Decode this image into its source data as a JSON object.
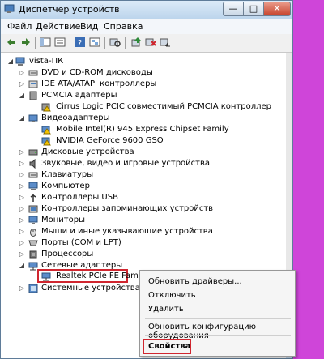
{
  "window": {
    "title": "Диспетчер устройств",
    "close_glyph": "✕",
    "min_glyph": "—",
    "max_glyph": "□"
  },
  "menu": [
    "Файл",
    "Действие",
    "Вид",
    "Справка"
  ],
  "toolbar_icons": [
    "back-arrow-icon",
    "forward-arrow-icon",
    "properties-panel-icon",
    "list-view-icon",
    "help-icon",
    "resources-view-icon",
    "scan-hardware-icon",
    "update-driver-icon",
    "uninstall-icon",
    "disable-device-icon"
  ],
  "tree": {
    "root": "vista-ПК",
    "items": [
      {
        "label": "DVD и CD-ROM дисководы",
        "expanded": false
      },
      {
        "label": "IDE ATA/ATAPI контроллеры",
        "expanded": false
      },
      {
        "label": "PCMCIA адаптеры",
        "expanded": true,
        "children": [
          "Cirrus Logic PCIC совместимый PCMCIA контроллер"
        ]
      },
      {
        "label": "Видеоадаптеры",
        "expanded": true,
        "children": [
          "Mobile Intel(R) 945 Express Chipset Family",
          "NVIDIA GeForce 9600 GSO"
        ]
      },
      {
        "label": "Дисковые устройства",
        "expanded": false
      },
      {
        "label": "Звуковые, видео и игровые устройства",
        "expanded": false
      },
      {
        "label": "Клавиатуры",
        "expanded": false
      },
      {
        "label": "Компьютер",
        "expanded": false
      },
      {
        "label": "Контроллеры USB",
        "expanded": false
      },
      {
        "label": "Контроллеры запоминающих устройств",
        "expanded": false
      },
      {
        "label": "Мониторы",
        "expanded": false
      },
      {
        "label": "Мыши и иные указывающие устройства",
        "expanded": false
      },
      {
        "label": "Порты (COM и LPT)",
        "expanded": false
      },
      {
        "label": "Процессоры",
        "expanded": false
      },
      {
        "label": "Сетевые адаптеры",
        "expanded": true,
        "children": [
          "Realtek PCIe FE Fami"
        ]
      },
      {
        "label": "Системные устройства",
        "expanded": false
      }
    ]
  },
  "context_menu": {
    "update_driver": "Обновить драйверы...",
    "disable": "Отключить",
    "uninstall": "Удалить",
    "scan": "Обновить конфигурацию оборудования",
    "properties": "Свойства"
  },
  "colors": {
    "highlight_border": "#d0262f",
    "background": "#cf45d9",
    "window_frame": "#c9dff3"
  }
}
